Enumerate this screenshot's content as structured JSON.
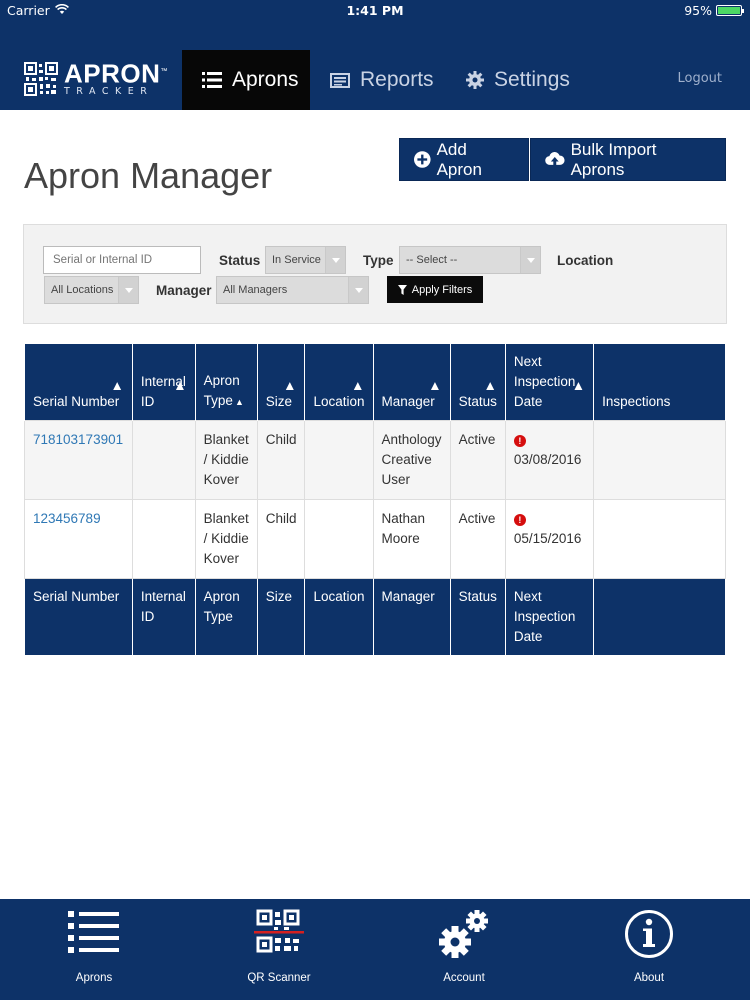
{
  "statusbar": {
    "carrier": "Carrier",
    "time": "1:41 PM",
    "battery": "95%"
  },
  "header": {
    "logo_main": "APRON",
    "logo_tm": "™",
    "logo_sub": "TRACKER",
    "nav": [
      {
        "label": "Aprons",
        "icon": "list-icon",
        "active": true
      },
      {
        "label": "Reports",
        "icon": "report-icon",
        "active": false
      },
      {
        "label": "Settings",
        "icon": "gear-icon",
        "active": false
      }
    ],
    "logout": "Logout"
  },
  "page": {
    "title": "Apron Manager",
    "add_button": "Add Apron",
    "bulk_button": "Bulk Import Aprons"
  },
  "filters": {
    "search_placeholder": "Serial or Internal ID",
    "status_label": "Status",
    "status_value": "In Service",
    "type_label": "Type",
    "type_value": "-- Select --",
    "location_label": "Location",
    "location_value": "All Locations",
    "manager_label": "Manager",
    "manager_value": "All Managers",
    "apply_label": "Apply Filters"
  },
  "table": {
    "headers": [
      "Serial Number",
      "Internal ID",
      "Apron Type",
      "Size",
      "Location",
      "Manager",
      "Status",
      "Next Inspection Date",
      "Inspections"
    ],
    "rows": [
      {
        "serial": "718103173901",
        "internal_id": "",
        "type": "Blanket / Kiddie Kover",
        "size": "Child",
        "location": "",
        "manager": "Anthology Creative User",
        "status": "Active",
        "next_inspection": "03/08/2016",
        "inspections": ""
      },
      {
        "serial": "123456789",
        "internal_id": "",
        "type": "Blanket / Kiddie Kover",
        "size": "Child",
        "location": "",
        "manager": "Nathan Moore",
        "status": "Active",
        "next_inspection": "05/15/2016",
        "inspections": ""
      }
    ],
    "footer": [
      "Serial Number",
      "Internal ID",
      "Apron Type",
      "Size",
      "Location",
      "Manager",
      "Status",
      "Next Inspection Date",
      ""
    ]
  },
  "tabbar": {
    "items": [
      {
        "label": "Aprons",
        "icon": "list-icon"
      },
      {
        "label": "QR Scanner",
        "icon": "qr-code-icon"
      },
      {
        "label": "Account",
        "icon": "gears-icon"
      },
      {
        "label": "About",
        "icon": "info-icon"
      }
    ]
  },
  "colors": {
    "brand_navy": "#0d3268",
    "active_nav": "#070707",
    "link_blue": "#2f78b5",
    "alert_red": "#d50e0e",
    "battery_green": "#4cd964"
  }
}
